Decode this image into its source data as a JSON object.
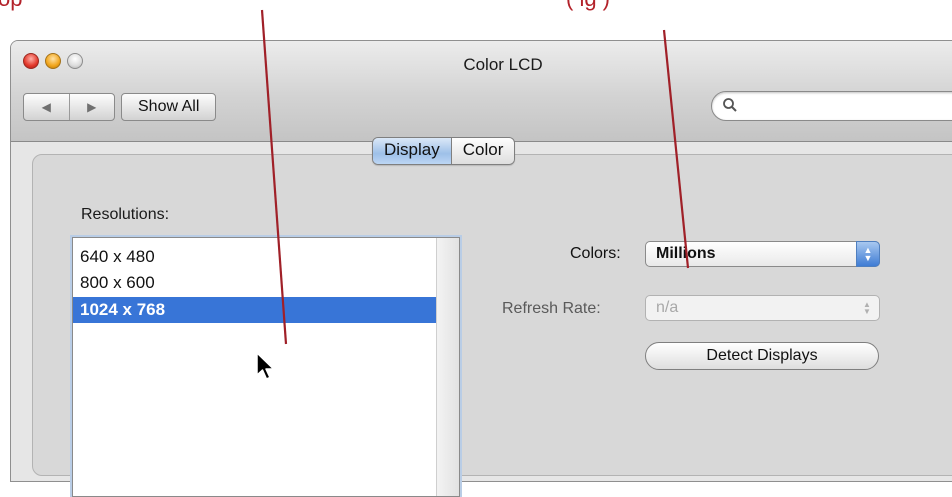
{
  "annotations": {
    "left_text": "op",
    "right_text": "(                    ig )",
    "color": "#b3222a"
  },
  "window": {
    "title": "Color LCD",
    "traffic_lights": [
      "close",
      "minimize",
      "zoom"
    ]
  },
  "toolbar": {
    "back_icon": "◀",
    "forward_icon": "▶",
    "show_all_label": "Show All",
    "search_placeholder": "",
    "search_icon": "search-icon"
  },
  "tabs": [
    {
      "label": "Display",
      "selected": true
    },
    {
      "label": "Color",
      "selected": false
    }
  ],
  "resolutions": {
    "label": "Resolutions:",
    "items": [
      {
        "label": "640 x 480",
        "selected": false
      },
      {
        "label": "800 x 600",
        "selected": false
      },
      {
        "label": "1024 x 768",
        "selected": true
      }
    ]
  },
  "colors": {
    "label": "Colors:",
    "value": "Millions"
  },
  "refresh_rate": {
    "label": "Refresh Rate:",
    "value": "n/a",
    "enabled": false
  },
  "detect_displays_label": "Detect Displays",
  "accent_color": "#3875d7"
}
